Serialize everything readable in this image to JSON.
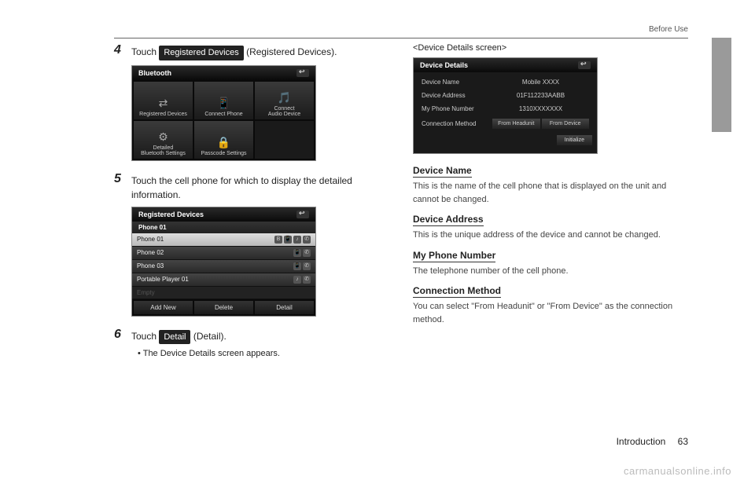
{
  "header": {
    "section": "Before Use"
  },
  "footer": {
    "section": "Introduction",
    "page": "63"
  },
  "watermark": "carmanualsonline.info",
  "steps": {
    "s4": {
      "num": "4",
      "pre": "Touch ",
      "button": "Registered Devices",
      "post": " (Registered Devices)."
    },
    "s5": {
      "num": "5",
      "text": "Touch the cell phone for which to display the detailed information."
    },
    "s6": {
      "num": "6",
      "pre": "Touch ",
      "button": "Detail",
      "post": " (Detail).",
      "bullet": "The Device Details screen appears."
    }
  },
  "bluetooth_screen": {
    "title": "Bluetooth",
    "cells": [
      {
        "icon": "⇄",
        "label": "Registered Devices"
      },
      {
        "icon": "📱",
        "label": "Connect Phone"
      },
      {
        "icon": "🎵",
        "label": "Connect\nAudio Device"
      },
      {
        "icon": "⚙",
        "label": "Detailed\nBluetooth Settings"
      },
      {
        "icon": "🔒",
        "label": "Passcode Settings"
      }
    ]
  },
  "registered_screen": {
    "title": "Registered Devices",
    "subtitle": "Phone 01",
    "rows": [
      {
        "name": "Phone 01",
        "selected": true,
        "icons": true
      },
      {
        "name": "Phone 02",
        "selected": false,
        "icons": true
      },
      {
        "name": "Phone 03",
        "selected": false,
        "icons": true
      },
      {
        "name": "Portable Player 01",
        "selected": false,
        "icons": true
      },
      {
        "name": "Empty",
        "selected": false,
        "empty": true
      }
    ],
    "footer": [
      "Add New",
      "Delete",
      "Detail"
    ]
  },
  "details_screen": {
    "angle": "<Device Details screen>",
    "title": "Device Details",
    "rows": {
      "name": {
        "label": "Device Name",
        "value": "Mobile XXXX"
      },
      "addr": {
        "label": "Device Address",
        "value": "01F112233AABB"
      },
      "num": {
        "label": "My Phone Number",
        "value": "1310XXXXXXX"
      },
      "conn": {
        "label": "Connection Method",
        "btn1": "From Headunit",
        "btn2": "From Device"
      }
    },
    "init": "Initialize"
  },
  "defs": {
    "d1": {
      "title": "Device Name",
      "text": "This is the name of the cell phone that is displayed on the unit and cannot be changed."
    },
    "d2": {
      "title": "Device Address",
      "text": "This is the unique address of the device and cannot be changed."
    },
    "d3": {
      "title": "My Phone Number",
      "text": "The telephone number of the cell phone."
    },
    "d4": {
      "title": "Connection Method",
      "text": "You can select \"From Headunit\" or \"From Device\" as the connection method."
    }
  }
}
